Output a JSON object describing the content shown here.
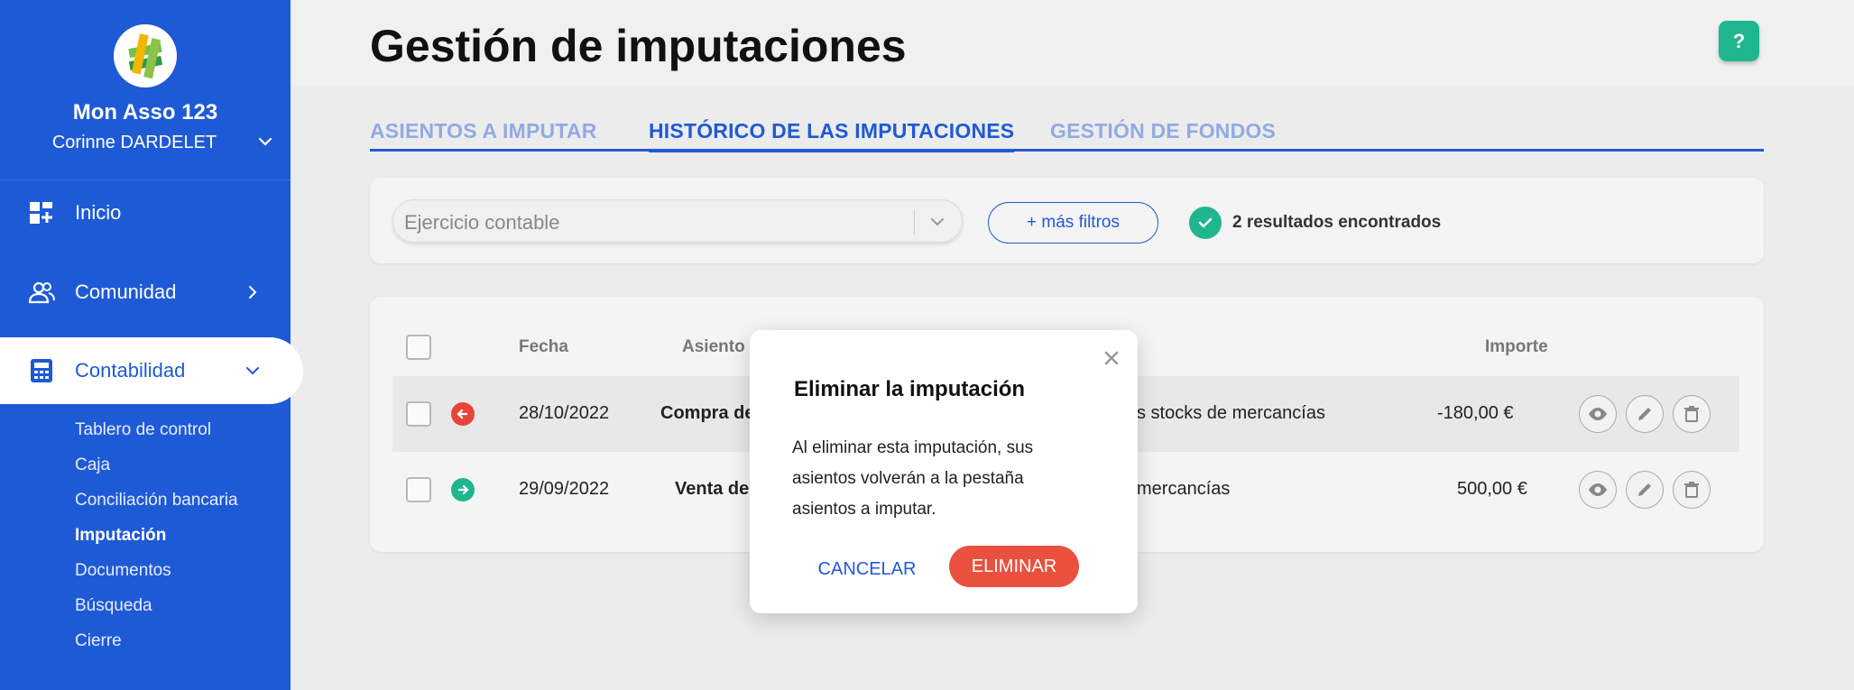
{
  "sidebar": {
    "org_name": "Mon Asso 123",
    "user_name": "Corinne DARDELET",
    "nav": [
      {
        "label": "Inicio",
        "icon": "dashboard-icon"
      },
      {
        "label": "Comunidad",
        "icon": "users-icon"
      },
      {
        "label": "Contabilidad",
        "icon": "calculator-icon"
      }
    ],
    "sub_items": [
      "Tablero de control",
      "Caja",
      "Conciliación bancaria",
      "Imputación",
      "Documentos",
      "Búsqueda",
      "Cierre"
    ],
    "active_sub": "Imputación"
  },
  "header": {
    "title": "Gestión de imputaciones",
    "help_label": "?"
  },
  "tabs": [
    {
      "label": "ASIENTOS A IMPUTAR",
      "active": false
    },
    {
      "label": "HISTÓRICO DE LAS IMPUTACIONES",
      "active": true
    },
    {
      "label": "GESTIÓN DE FONDOS",
      "active": false
    }
  ],
  "filters": {
    "select_placeholder": "Ejercicio contable",
    "more_filters": "+ más filtros",
    "results_text": "2 resultados encontrados"
  },
  "table": {
    "headers": {
      "date": "Fecha",
      "entry": "Asiento",
      "amount": "Importe"
    },
    "rows": [
      {
        "direction": "out",
        "date": "28/10/2022",
        "entry": "Compra de",
        "account": "s stocks de mercancías",
        "amount": "-180,00 €"
      },
      {
        "direction": "in",
        "date": "29/09/2022",
        "entry": "Venta de",
        "account": "mercancías",
        "amount": "500,00 €"
      }
    ]
  },
  "modal": {
    "title": "Eliminar la imputación",
    "body": "Al eliminar esta imputación, sus asientos volverán a la pestaña asientos a imputar.",
    "cancel_label": "CANCELAR",
    "delete_label": "ELIMINAR"
  },
  "colors": {
    "brand_blue": "#1f5ad6",
    "success_green": "#1fb58f",
    "danger_red": "#e9513e",
    "out_red": "#e8453a"
  }
}
